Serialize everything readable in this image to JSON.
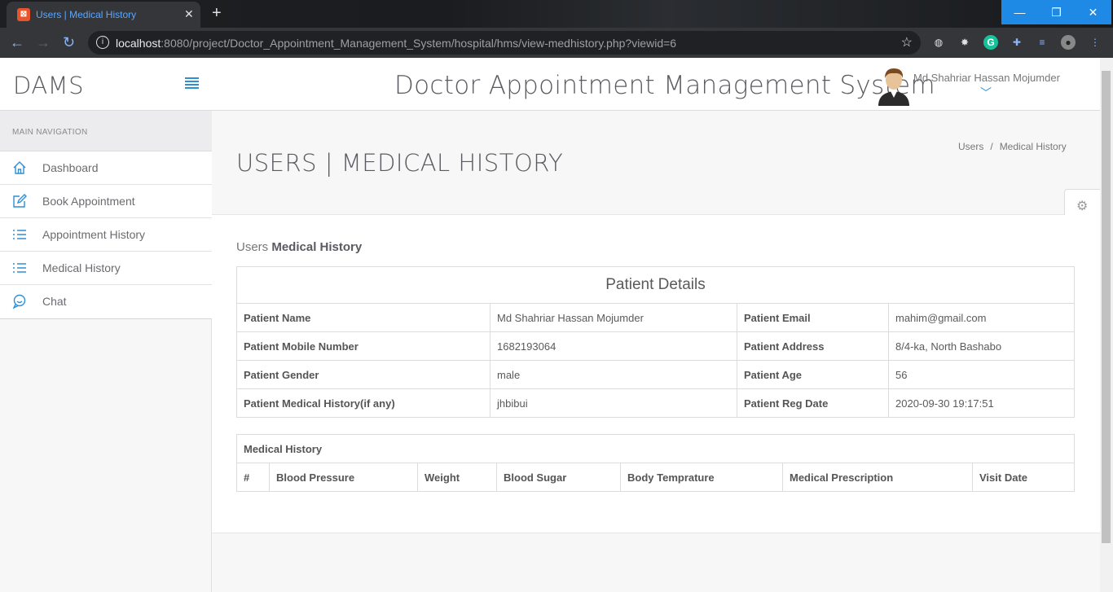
{
  "browser": {
    "tab_title": "Users | Medical History",
    "tab_close": "✕",
    "new_tab": "+",
    "url_host": "localhost",
    "url_rest": ":8080/project/Doctor_Appointment_Management_System/hospital/hms/view-medhistory.php?viewid=6",
    "window_controls": {
      "minimize": "—",
      "maximize": "❐",
      "close": "✕"
    }
  },
  "sidebar": {
    "brand": "DAMS",
    "nav_heading": "MAIN NAVIGATION",
    "items": [
      {
        "label": "Dashboard",
        "icon": "home-icon"
      },
      {
        "label": "Book Appointment",
        "icon": "edit-icon"
      },
      {
        "label": "Appointment History",
        "icon": "list-icon"
      },
      {
        "label": "Medical History",
        "icon": "list-icon"
      },
      {
        "label": "Chat",
        "icon": "chat-icon"
      }
    ]
  },
  "header": {
    "system_title": "Doctor Appointment Management System",
    "user_name": "Md Shahriar Hassan Mojumder"
  },
  "page": {
    "title": "USERS | MEDICAL HISTORY",
    "breadcrumb": [
      "Users",
      "/",
      "Medical History"
    ],
    "section_light": "Users",
    "section_bold": "Medical History"
  },
  "patient_details": {
    "caption": "Patient Details",
    "rows": [
      [
        "Patient Name",
        "Md Shahriar Hassan Mojumder",
        "Patient Email",
        "mahim@gmail.com"
      ],
      [
        "Patient Mobile Number",
        "1682193064",
        "Patient Address",
        "8/4-ka, North Bashabo"
      ],
      [
        "Patient Gender",
        "male",
        "Patient Age",
        "56"
      ],
      [
        "Patient Medical History(if any)",
        "jhbibui",
        "Patient Reg Date",
        "2020-09-30 19:17:51"
      ]
    ]
  },
  "medical_history": {
    "caption": "Medical History",
    "columns": [
      "#",
      "Blood Pressure",
      "Weight",
      "Blood Sugar",
      "Body Temprature",
      "Medical Prescription",
      "Visit Date"
    ]
  },
  "colors": {
    "accent": "#2d8fd5",
    "tab_text": "#5aa7ff",
    "window_btn": "#1e8ae6"
  }
}
